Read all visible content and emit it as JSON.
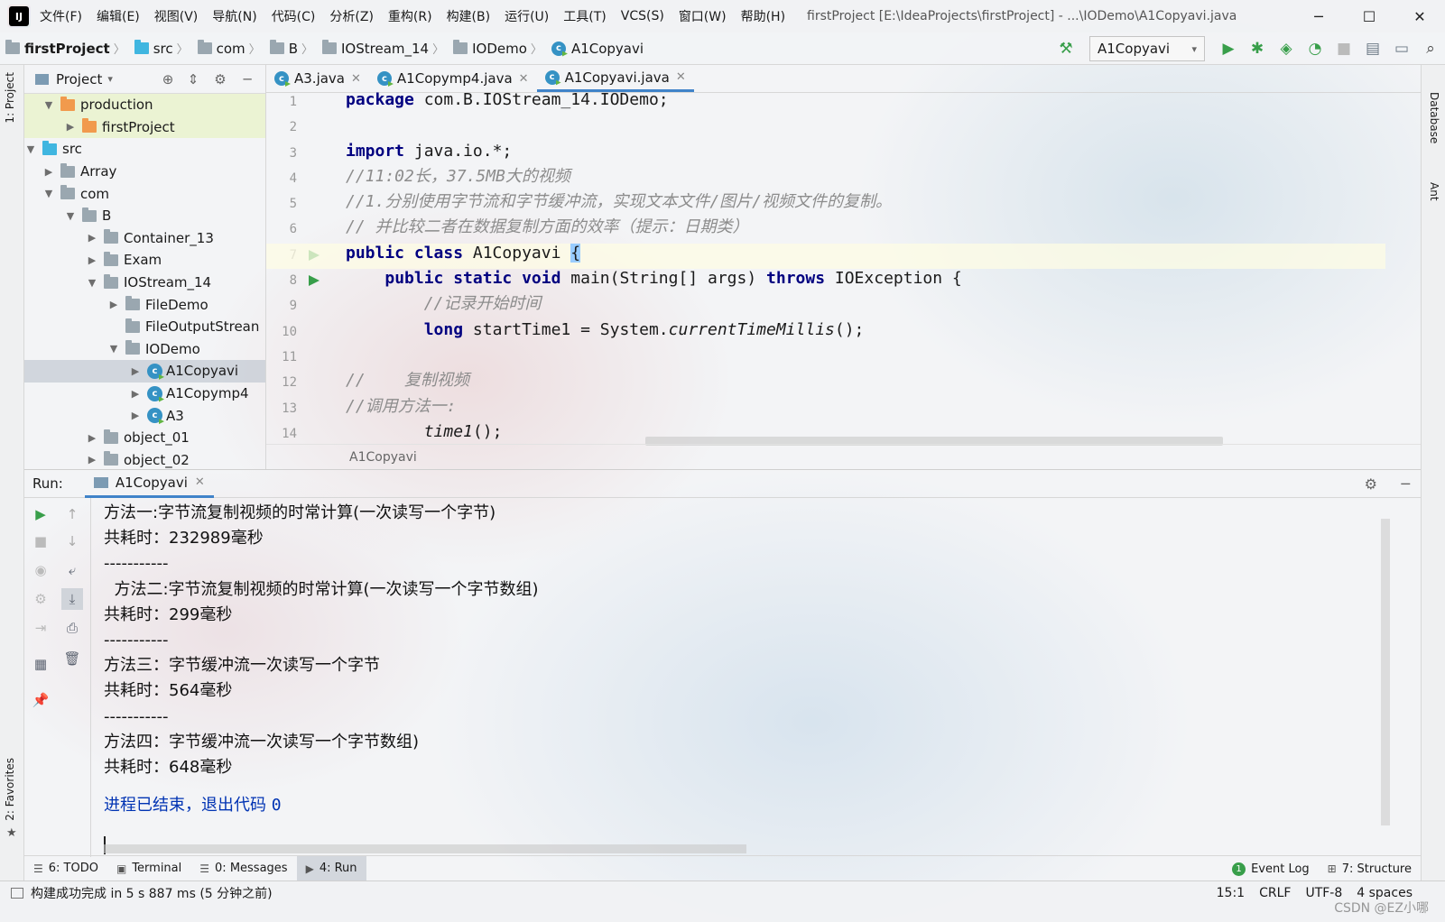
{
  "menubar": {
    "items": [
      "文件(F)",
      "编辑(E)",
      "视图(V)",
      "导航(N)",
      "代码(C)",
      "分析(Z)",
      "重构(R)",
      "构建(B)",
      "运行(U)",
      "工具(T)",
      "VCS(S)",
      "窗口(W)",
      "帮助(H)"
    ],
    "window_title": "firstProject [E:\\IdeaProjects\\firstProject] - ...\\IODemo\\A1Copyavi.java"
  },
  "navbar": {
    "crumbs": [
      "firstProject",
      "src",
      "com",
      "B",
      "IOStream_14",
      "IODemo",
      "A1Copyavi"
    ],
    "run_config": "A1Copyavi"
  },
  "left_strip": {
    "project_tab": "1: Project",
    "favorites_tab": "2: Favorites"
  },
  "right_strip": {
    "database_tab": "Database",
    "ant_tab": "Ant"
  },
  "project_panel": {
    "title": "Project",
    "tree": [
      {
        "label": "production",
        "depth": 1,
        "expanded": true,
        "icon": "folder-orange"
      },
      {
        "label": "firstProject",
        "depth": 2,
        "expanded": false,
        "icon": "folder-orange"
      },
      {
        "label": "src",
        "depth": 0,
        "expanded": true,
        "icon": "folder-blue"
      },
      {
        "label": "Array",
        "depth": 1,
        "expanded": false,
        "icon": "package"
      },
      {
        "label": "com",
        "depth": 1,
        "expanded": true,
        "icon": "package"
      },
      {
        "label": "B",
        "depth": 2,
        "expanded": true,
        "icon": "package"
      },
      {
        "label": "Container_13",
        "depth": 3,
        "expanded": false,
        "icon": "package"
      },
      {
        "label": "Exam",
        "depth": 3,
        "expanded": false,
        "icon": "package"
      },
      {
        "label": "IOStream_14",
        "depth": 3,
        "expanded": true,
        "icon": "package"
      },
      {
        "label": "FileDemo",
        "depth": 4,
        "expanded": false,
        "icon": "package"
      },
      {
        "label": "FileOutputStrean",
        "depth": 4,
        "expanded": null,
        "icon": "package"
      },
      {
        "label": "IODemo",
        "depth": 4,
        "expanded": true,
        "icon": "package"
      },
      {
        "label": "A1Copyavi",
        "depth": 5,
        "expanded": false,
        "icon": "class",
        "selected": true
      },
      {
        "label": "A1Copymp4",
        "depth": 5,
        "expanded": false,
        "icon": "class"
      },
      {
        "label": "A3",
        "depth": 5,
        "expanded": false,
        "icon": "class"
      },
      {
        "label": "object_01",
        "depth": 3,
        "expanded": false,
        "icon": "package"
      },
      {
        "label": "object_02",
        "depth": 3,
        "expanded": false,
        "icon": "package"
      }
    ]
  },
  "editor": {
    "tabs": [
      {
        "label": "A3.java",
        "active": false
      },
      {
        "label": "A1Copymp4.java",
        "active": false
      },
      {
        "label": "A1Copyavi.java",
        "active": true
      }
    ],
    "line_numbers": [
      "1",
      "2",
      "3",
      "4",
      "5",
      "6",
      "7",
      "8",
      "9",
      "10",
      "11",
      "12",
      "13",
      "14"
    ],
    "lines": [
      {
        "n": "1"
      },
      {
        "n": "2"
      },
      {
        "n": "3"
      },
      {
        "n": "4",
        "comment": "//11:02长，37.5MB大的视频"
      },
      {
        "n": "5",
        "comment": "//1.分别使用字节流和字节缓冲流，实现文本文件/图片/视频文件的复制。"
      },
      {
        "n": "6",
        "comment": "// 并比较二者在数据复制方面的效率（提示：日期类）"
      },
      {
        "n": "7"
      },
      {
        "n": "8"
      },
      {
        "n": "9",
        "comment": "//记录开始时间"
      },
      {
        "n": "10"
      },
      {
        "n": "11"
      },
      {
        "n": "12",
        "comment": "//    复制视频"
      },
      {
        "n": "13",
        "comment": "//调用方法一:"
      },
      {
        "n": "14"
      }
    ],
    "code": {
      "line1_kw": "package",
      "line1_rest": " com.B.IOStream_14.IODemo;",
      "line3_kw": "import",
      "line3_rest": " java.io.*;",
      "line7_kw": "public class",
      "line7_rest": " A1Copyavi ",
      "line7_brace": "{",
      "line8_kw1": "public static void",
      "line8_mid": " main(String[] args) ",
      "line8_kw2": "throws",
      "line8_rest": " IOException {",
      "line10_kw": "long",
      "line10_mid": " startTime1 = System.",
      "line10_it": "currentTimeMillis",
      "line10_rest": "();",
      "line14_it": "time1",
      "line14_rest": "();"
    },
    "breadcrumb": "A1Copyavi"
  },
  "run_panel": {
    "label": "Run:",
    "tab": "A1Copyavi",
    "output": [
      "方法一:字节流复制视频的时常计算(一次读写一个字节)",
      "共耗时：232989毫秒",
      "-----------",
      "  方法二:字节流复制视频的时常计算(一次读写一个字节数组)",
      "共耗时：299毫秒",
      "-----------",
      "方法三：字节缓冲流一次读写一个字节",
      "共耗时：564毫秒",
      "-----------",
      "方法四：字节缓冲流一次读写一个字节数组)",
      "共耗时：648毫秒"
    ],
    "exit_line_text": "进程已结束，退出代码 ",
    "exit_code": "0"
  },
  "bottom_tabs": {
    "todo": "6: TODO",
    "terminal": "Terminal",
    "messages": "0: Messages",
    "run": "4: Run",
    "event_log": "Event Log",
    "structure": "7: Structure"
  },
  "statusbar": {
    "message": "构建成功完成 in 5 s 887 ms (5 分钟之前)",
    "position": "15:1",
    "line_sep": "CRLF",
    "encoding": "UTF-8",
    "indent": "4 spaces",
    "watermark": "CSDN @EZ小哪"
  }
}
